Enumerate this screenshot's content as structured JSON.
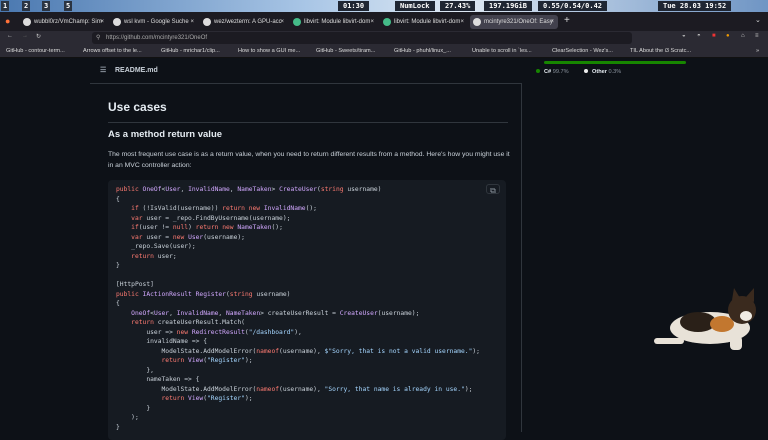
{
  "panel": {
    "workspaces": [
      "1",
      "2",
      "3",
      "5"
    ],
    "time_left": "01:30",
    "numlock": "NumLock",
    "cpu": "27.43%",
    "disk": "197.19GiB",
    "load": "0.55/0.54/0.42",
    "datetime": "Tue 28.03 19:52"
  },
  "tabs": [
    {
      "label": "wubbl0rz/VmChamp: Sim"
    },
    {
      "label": "wsl kvm - Google Suche"
    },
    {
      "label": "wez/wezterm: A GPU-acc"
    },
    {
      "label": "libvirt: Module libvirt-dom"
    },
    {
      "label": "libvirt: Module libvirt-dom"
    },
    {
      "label": "mcintyre321/OneOf: Easy"
    }
  ],
  "url": "https://github.com/mcintyre321/OneOf",
  "bookmarks": [
    "GitHub - contour-term...",
    "Arrows offset to the le...",
    "GitHub - mrichar1/clip...",
    "How to show a GUI me...",
    "GitHub - Sweets/tiram...",
    "GitHub - phuhl/linux_...",
    "Unable to scroll in `les...",
    "ClearSelection - Wez's...",
    "TIL About the i3 Scratc..."
  ],
  "readme": {
    "title": "README.md",
    "h2": "Use cases",
    "h3": "As a method return value",
    "para": "The most frequent use case is as a return value, when you need to return different results from a method. Here's how you might use it in an MVC controller action:"
  },
  "code": [
    "public OneOf<User, InvalidName, NameTaken> CreateUser(string username)",
    "{",
    "    if (!IsValid(username)) return new InvalidName();",
    "    var user = _repo.FindByUsername(username);",
    "    if(user != null) return new NameTaken();",
    "    var user = new User(username);",
    "    _repo.Save(user);",
    "    return user;",
    "}",
    "",
    "[HttpPost]",
    "public IActionResult Register(string username)",
    "{",
    "    OneOf<User, InvalidName, NameTaken> createUserResult = CreateUser(username);",
    "    return createUserResult.Match(",
    "        user => new RedirectResult(\"/dashboard\"),",
    "        invalidName => {",
    "            ModelState.AddModelError(nameof(username), $\"Sorry, that is not a valid username.\");",
    "            return View(\"Register\");",
    "        },",
    "        nameTaken => {",
    "            ModelState.AddModelError(nameof(username), \"Sorry, that name is already in use.\");",
    "            return View(\"Register\");",
    "        }",
    "    );",
    "}"
  ],
  "languages": [
    {
      "name": "C#",
      "percent": "99.7%",
      "color": "#178600"
    },
    {
      "name": "Other",
      "percent": "0.3%",
      "color": "#ededed"
    }
  ]
}
